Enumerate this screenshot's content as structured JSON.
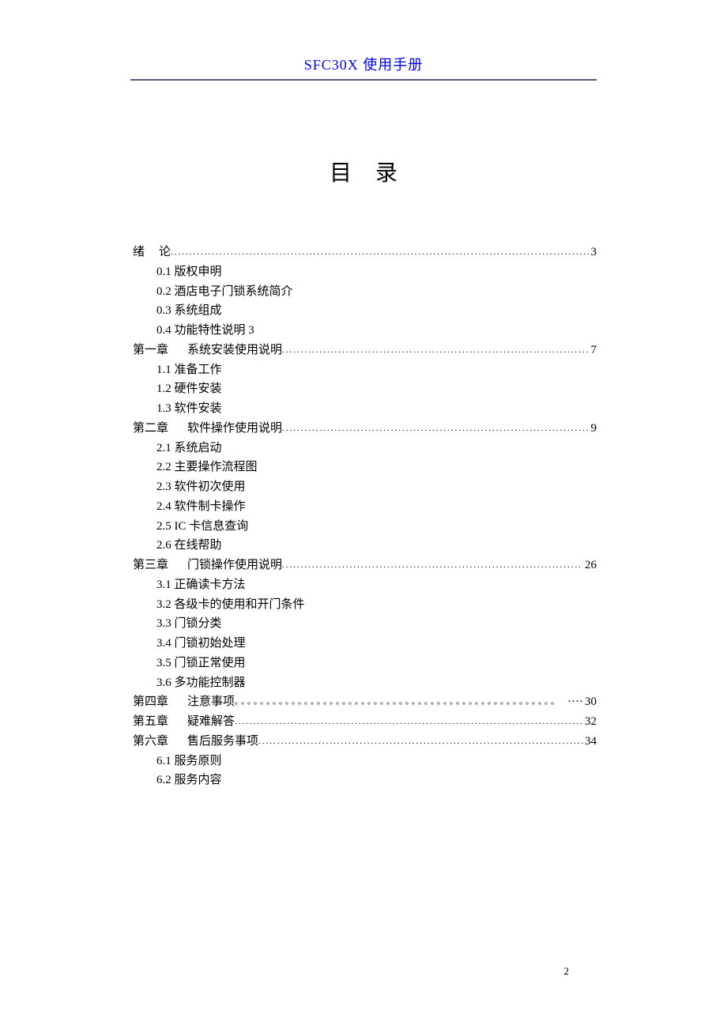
{
  "header": {
    "title": "SFC30X 使用手册"
  },
  "main_title": "目录",
  "toc": {
    "intro": {
      "label": "绪",
      "title": "论",
      "page": "3",
      "items": [
        "0.1 版权申明",
        "0.2 酒店电子门锁系统简介",
        "0.3 系统组成",
        "0.4 功能特性说明 3"
      ]
    },
    "ch1": {
      "label": "第一章",
      "title": "系统安装使用说明",
      "page": "7",
      "items": [
        "1.1 准备工作",
        "1.2 硬件安装",
        "1.3 软件安装"
      ]
    },
    "ch2": {
      "label": "第二章",
      "title": "软件操作使用说明",
      "page": "9",
      "items": [
        "2.1 系统启动",
        "2.2 主要操作流程图",
        "2.3 软件初次使用",
        "2.4 软件制卡操作",
        "2.5 IC 卡信息查询",
        "2.6 在线帮助"
      ]
    },
    "ch3": {
      "label": "第三章",
      "title": "门锁操作使用说明",
      "page": "26",
      "items": [
        "3.1 正确读卡方法",
        "3.2 各级卡的使用和开门条件",
        "3.3 门锁分类",
        "3.4 门锁初始处理",
        "3.5 门锁正常使用",
        "3.6 多功能控制器"
      ]
    },
    "ch4": {
      "label": "第四章",
      "title": "注意事项",
      "page_prefix": "····  ",
      "page": "30"
    },
    "ch5": {
      "label": "第五章",
      "title": "疑难解答",
      "page": "32"
    },
    "ch6": {
      "label": "第六章",
      "title": "售后服务事项",
      "page": "34",
      "items": [
        "6.1 服务原则",
        "6.2 服务内容"
      ]
    }
  },
  "page_number": "2",
  "dots": "...........................................................................................................................................................................................................",
  "circles": "。。。。。。。。。。。。。。。。。。。。。。。。。。。。。。。。。。。。。。。。。。。。。。。。。。。"
}
